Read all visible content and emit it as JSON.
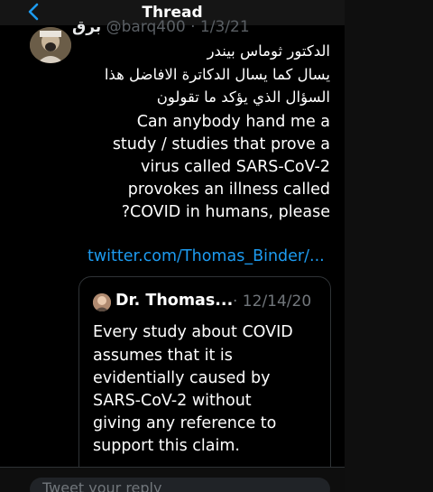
{
  "nav": {
    "title": "Thread"
  },
  "tweet": {
    "author_name": "برق",
    "author_handle": "@barq400 · 1/3/21",
    "arabic_lines": [
      "الدكتور ثوماس بيندر",
      "يسال كما يسال الدكاترة الافاضل هذا",
      "السؤال الذي يؤكد ما تقولون"
    ],
    "english_lines": [
      "Can anybody hand me a",
      "study / studies that prove a",
      "virus called SARS-CoV-2",
      "provokes an illness called",
      "?COVID in humans, please"
    ],
    "link": "twitter.com/Thomas_Binder/..."
  },
  "quoted": {
    "name": "Dr. Thomas...",
    "date": "· 12/14/20",
    "lines": [
      "Every study about COVID",
      "assumes that it is",
      "evidentially caused by",
      "SARS-CoV-2 without",
      "giving any reference to",
      "support this claim."
    ]
  },
  "reply": {
    "placeholder": "Tweet your reply"
  },
  "colors": {
    "accent": "#1d9bf0",
    "background": "#000000",
    "muted": "#71767b"
  }
}
